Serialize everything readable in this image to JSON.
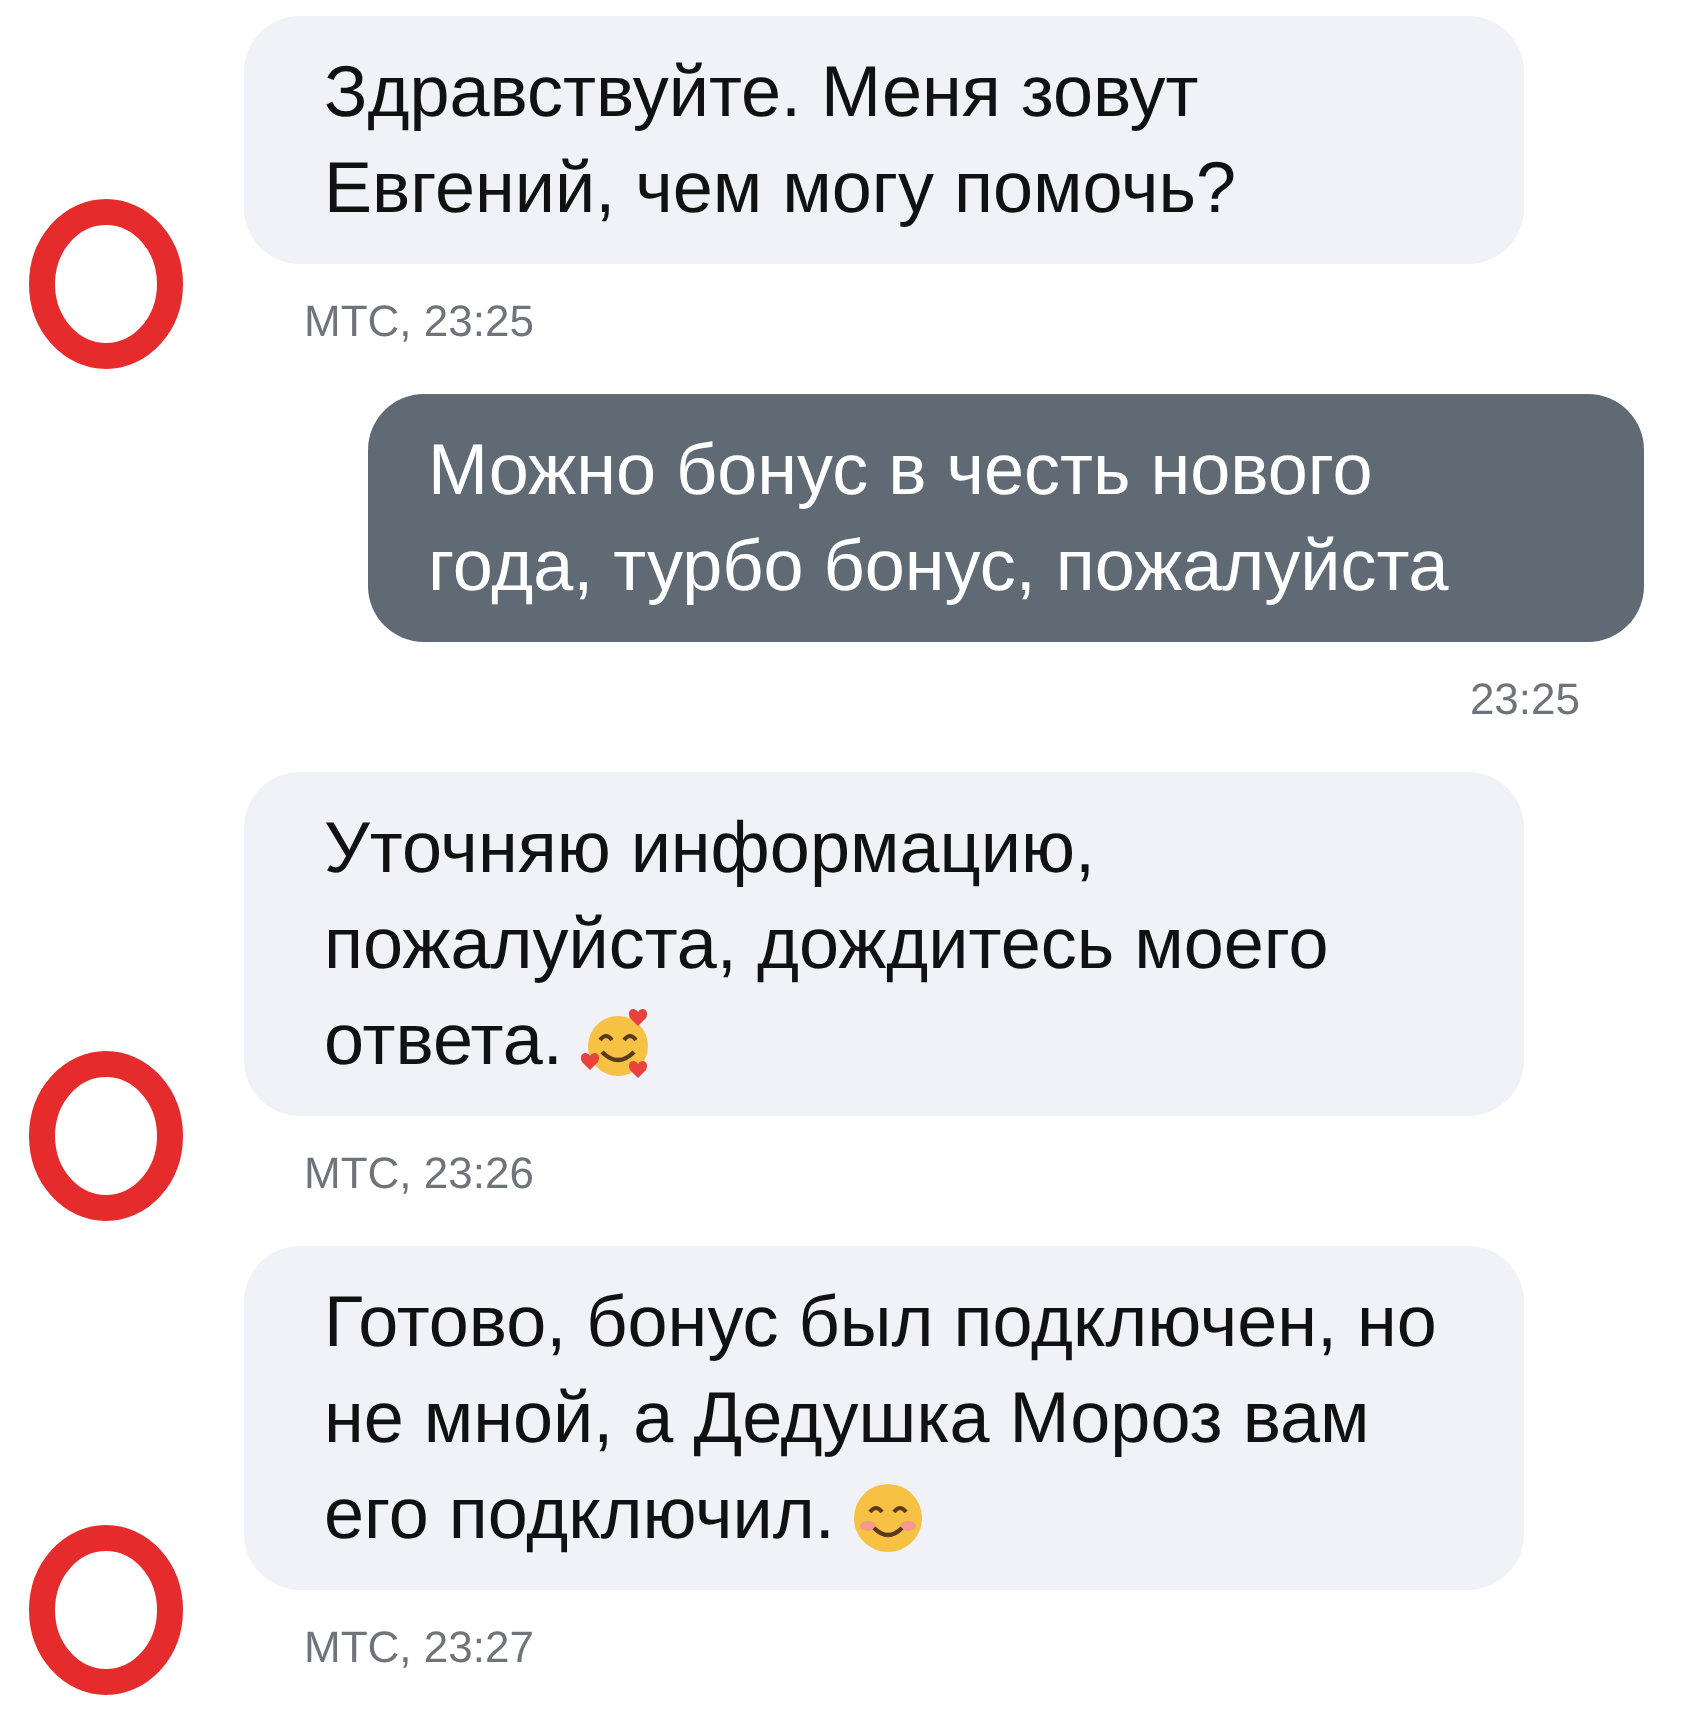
{
  "messages": [
    {
      "kind": "agent",
      "text": "Здравствуйте. Меня зовут Евгений, чем могу помочь?",
      "meta": "МТС, 23:25"
    },
    {
      "kind": "user",
      "text": "Можно бонус в честь нового года, турбо бонус, пожалуйста",
      "meta": "23:25"
    },
    {
      "kind": "agent",
      "text": "Уточняю информацию, пожалуйста, дождитесь моего ответа.",
      "emoji": {
        "kind": "hearts"
      },
      "meta": "МТС, 23:26"
    },
    {
      "kind": "agent",
      "text": "Готово, бонус был подключен, но не мной, а Дедушка Мороз вам его подключил.",
      "emoji": {
        "kind": "smile"
      },
      "meta": "МТС, 23:27"
    }
  ]
}
